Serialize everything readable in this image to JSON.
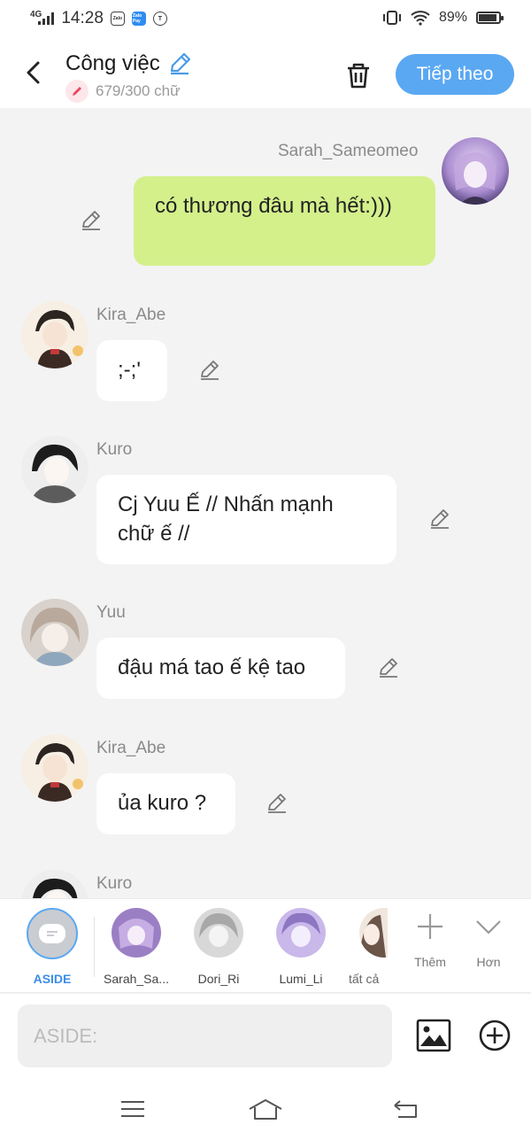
{
  "status_bar": {
    "network": "4G",
    "time": "14:28",
    "apps": [
      "Zalo",
      "Zalo Pay",
      "T"
    ],
    "battery": "89%",
    "battery_level": 0.89
  },
  "header": {
    "title": "Công việc",
    "word_count": "679/300 chữ",
    "next_button": "Tiếp theo"
  },
  "messages": [
    {
      "sender": "Sarah_Sameomeo",
      "text": "có thương đâu mà hết:)))",
      "side": "right"
    },
    {
      "sender": "Kira_Abe",
      "text": ";-;'",
      "side": "left"
    },
    {
      "sender": "Kuro",
      "text": "Cj Yuu Ế // Nhấn mạnh chữ ế //",
      "side": "left"
    },
    {
      "sender": "Yuu",
      "text": "đậu má tao ế kệ tao",
      "side": "left"
    },
    {
      "sender": "Kira_Abe",
      "text": "ủa kuro ?",
      "side": "left"
    },
    {
      "sender": "Kuro",
      "text": "",
      "side": "left"
    }
  ],
  "roles": {
    "items": [
      {
        "label": "ASIDE",
        "selected": true
      },
      {
        "label": "Sarah_Sa..."
      },
      {
        "label": "Dori_Ri"
      },
      {
        "label": "Lumi_Li"
      },
      {
        "label": "tất cả"
      }
    ],
    "more_label": "Thêm",
    "expand_label": "Hơn"
  },
  "composer": {
    "placeholder": "ASIDE:"
  },
  "colors": {
    "accent": "#5aa8f2",
    "my_bubble": "#d4f08b",
    "background": "#f3f3f3"
  }
}
